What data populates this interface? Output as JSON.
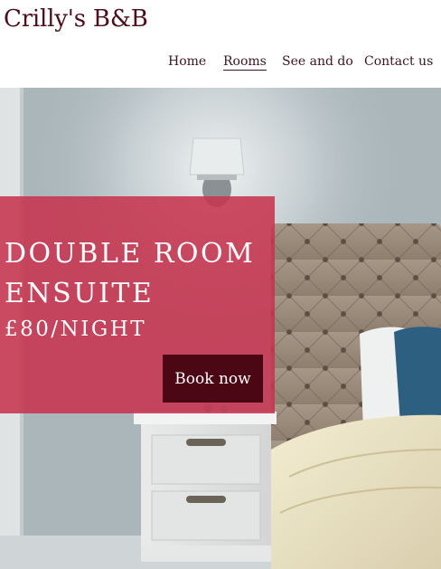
{
  "site": {
    "title": "Crilly's B&B"
  },
  "nav": {
    "items": [
      {
        "label": "Home",
        "active": false
      },
      {
        "label": "Rooms",
        "active": true
      },
      {
        "label": "See and do",
        "active": false
      },
      {
        "label": "Contact us",
        "active": false
      }
    ]
  },
  "hero": {
    "room_title": "Double Room Ensuite",
    "price": "£80/NIGHT",
    "cta_label": "Book now",
    "overlay_color": "#c6344e",
    "button_color": "#4c0714"
  },
  "colors": {
    "brand": "#4a0e1c"
  }
}
